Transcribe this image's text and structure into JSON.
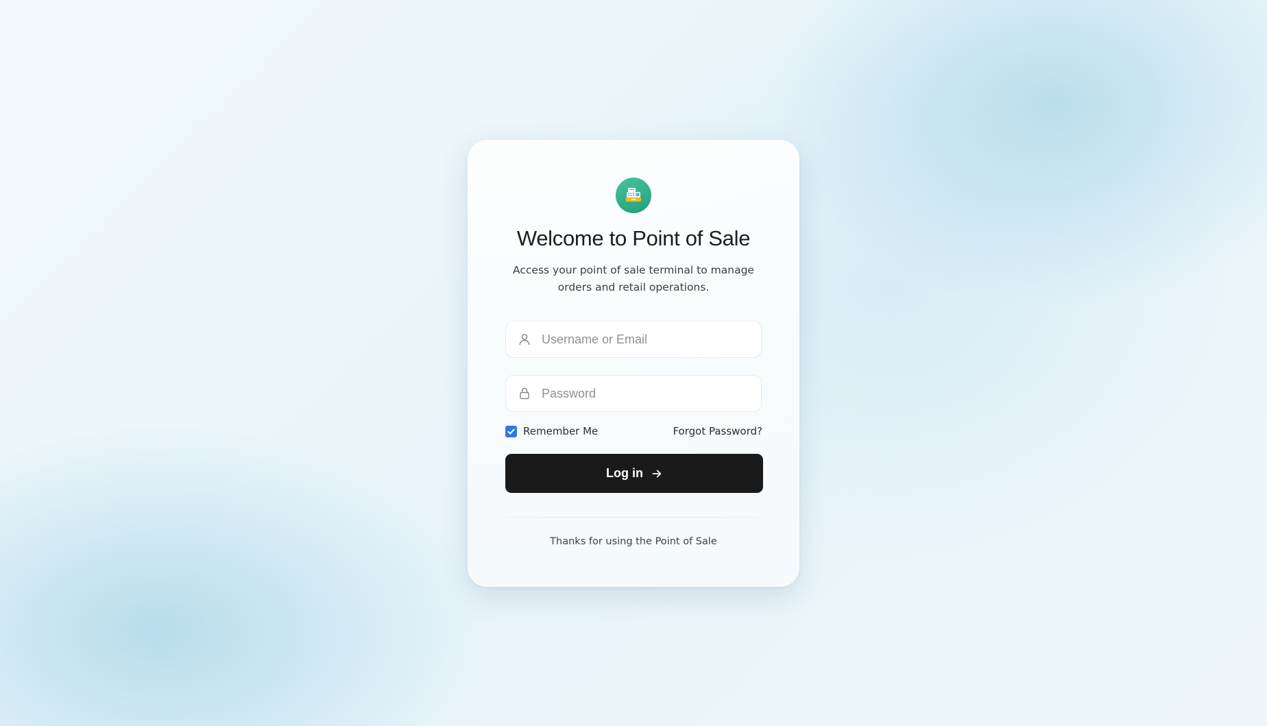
{
  "colors": {
    "logo_green": "#2fb187",
    "button_dark": "#1a1a1a",
    "checkbox_blue": "#2f78e4",
    "background": "#eaf5fa"
  },
  "login_card": {
    "logo_icon": "cash-register-icon",
    "title": "Welcome to Point of Sale",
    "subtitle": "Access your point of sale terminal to manage orders and retail operations.",
    "username": {
      "icon": "user-icon",
      "placeholder": "Username or Email",
      "value": ""
    },
    "password": {
      "icon": "lock-icon",
      "placeholder": "Password",
      "value": ""
    },
    "remember_me": {
      "label": "Remember Me",
      "checked": true
    },
    "forgot_password": "Forgot Password?",
    "login_button": {
      "label": "Log in",
      "icon": "arrow-right-icon"
    },
    "footer": "Thanks for using the Point of Sale"
  }
}
